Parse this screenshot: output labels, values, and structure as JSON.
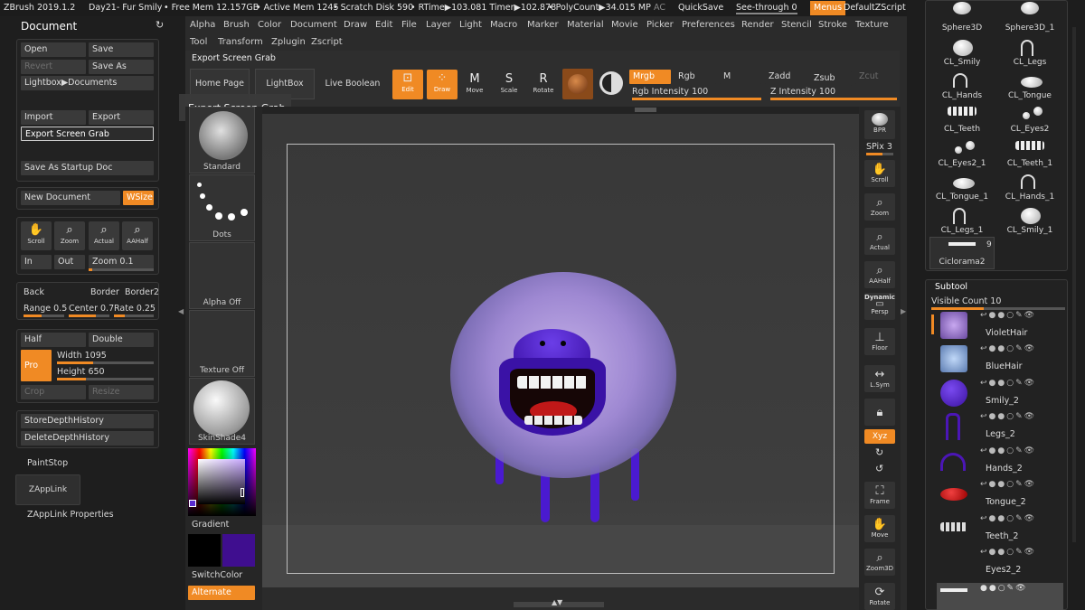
{
  "topbar": {
    "app": "ZBrush 2019.1.2",
    "doc": "Day21- Fur Smily",
    "free_mem": "• Free Mem 12.157GB",
    "active_mem": "• Active Mem 1245",
    "scratch": "• Scratch Disk 590",
    "rtime": "• RTime▶103.081 Timer▶102.878",
    "polycount": "• PolyCount▶34.015 MP",
    "ac": "AC",
    "quicksave": "QuickSave",
    "see_through": "See-through  0",
    "menus": "Menus",
    "script": "DefaultZScript"
  },
  "menu_row1": [
    "Alpha",
    "Brush",
    "Color",
    "Document",
    "Draw",
    "Edit",
    "File",
    "Layer",
    "Light",
    "Macro",
    "Marker",
    "Material",
    "Movie",
    "Picker",
    "Preferences",
    "Render",
    "Stencil",
    "Stroke",
    "Texture"
  ],
  "menu_row2": [
    "Tool",
    "Transform",
    "Zplugin",
    "Zscript"
  ],
  "document": {
    "title": "Document",
    "open": "Open",
    "save": "Save",
    "revert": "Revert",
    "save_as": "Save As",
    "lightbox_docs": "Lightbox▶Documents",
    "import": "Import",
    "export": "Export",
    "export_grab": "Export Screen Grab",
    "save_startup": "Save As Startup Doc",
    "new_doc": "New Document",
    "wsize": "WSize",
    "scroll": "Scroll",
    "zoom": "Zoom",
    "actual": "Actual",
    "aahalf": "AAHalf",
    "in": "In",
    "out": "Out",
    "zoom_label": "Zoom",
    "zoom_value": "0.1",
    "back": "Back",
    "border": "Border",
    "border2": "Border2",
    "range_label": "Range",
    "range_value": "0.5",
    "center_label": "Center",
    "center_value": "0.7",
    "rate_label": "Rate",
    "rate_value": "0.25",
    "half": "Half",
    "double": "Double",
    "pro": "Pro",
    "width_label": "Width",
    "width_value": "1095",
    "height_label": "Height",
    "height_value": "650",
    "crop": "Crop",
    "resize": "Resize",
    "store_depth": "StoreDepthHistory",
    "delete_depth": "DeleteDepthHistory",
    "paintstop": "PaintStop",
    "zapplink": "ZAppLink",
    "zapplink_props": "ZAppLink Properties"
  },
  "shelf": {
    "export_label": "Export Screen Grab",
    "tooltip": "Export Screen Grab",
    "home": "Home Page",
    "lightbox": "LightBox",
    "live_boolean": "Live Boolean",
    "edit": "Edit",
    "draw": "Draw",
    "move": "Move",
    "scale": "Scale",
    "rotate": "Rotate",
    "mrgb": "Mrgb",
    "rgb": "Rgb",
    "m": "M",
    "zadd": "Zadd",
    "zsub": "Zsub",
    "zcut": "Zcut",
    "rgb_intensity_label": "Rgb Intensity",
    "rgb_intensity_value": "100",
    "z_intensity_label": "Z Intensity",
    "z_intensity_value": "100"
  },
  "tray": {
    "standard": "Standard",
    "dots": "Dots",
    "alpha_off": "Alpha Off",
    "texture_off": "Texture Off",
    "skinshade": "SkinShade4",
    "gradient": "Gradient",
    "switchcolor": "SwitchColor",
    "alternate": "Alternate"
  },
  "colors": {
    "accent": "#f08a24",
    "primary": "#000000",
    "secondary": "#3f0e8f"
  },
  "right_bar": {
    "bpr": "BPR",
    "spix_label": "SPix",
    "spix_value": "3",
    "scroll": "Scroll",
    "zoom": "Zoom",
    "actual": "Actual",
    "aahalf": "AAHalf",
    "dynamic": "Dynamic",
    "persp": "Persp",
    "floor": "Floor",
    "lsym": "L.Sym",
    "xyz": "Xyz",
    "frame": "Frame",
    "move": "Move",
    "zoom3d": "Zoom3D",
    "rotate": "Rotate"
  },
  "tools": [
    {
      "name": "Sphere3D"
    },
    {
      "name": "Sphere3D_1"
    },
    {
      "name": "CL_Smily"
    },
    {
      "name": "CL_Legs"
    },
    {
      "name": "CL_Hands"
    },
    {
      "name": "CL_Tongue"
    },
    {
      "name": "CL_Teeth"
    },
    {
      "name": "CL_Eyes2"
    },
    {
      "name": "CL_Eyes2_1"
    },
    {
      "name": "CL_Teeth_1"
    },
    {
      "name": "CL_Tongue_1"
    },
    {
      "name": "CL_Hands_1"
    },
    {
      "name": "CL_Legs_1"
    },
    {
      "name": "CL_Smily_1"
    }
  ],
  "ciclorama": {
    "name": "Ciclorama2",
    "count": "9"
  },
  "subtool": {
    "title": "Subtool",
    "visible_label": "Visible Count",
    "visible_value": "10",
    "items": [
      {
        "name": "VioletHair",
        "color": "#a98ad6"
      },
      {
        "name": "BlueHair",
        "color": "#8db3e0"
      },
      {
        "name": "Smily_2",
        "color": "#4b16b6"
      },
      {
        "name": "Legs_2",
        "color": "#4b16b6"
      },
      {
        "name": "Hands_2",
        "color": "#4b16b6"
      },
      {
        "name": "Tongue_2",
        "color": "#c41a1a"
      },
      {
        "name": "Teeth_2",
        "color": "#e8e8e8"
      },
      {
        "name": "Eyes2_2",
        "color": "#222222"
      }
    ]
  }
}
